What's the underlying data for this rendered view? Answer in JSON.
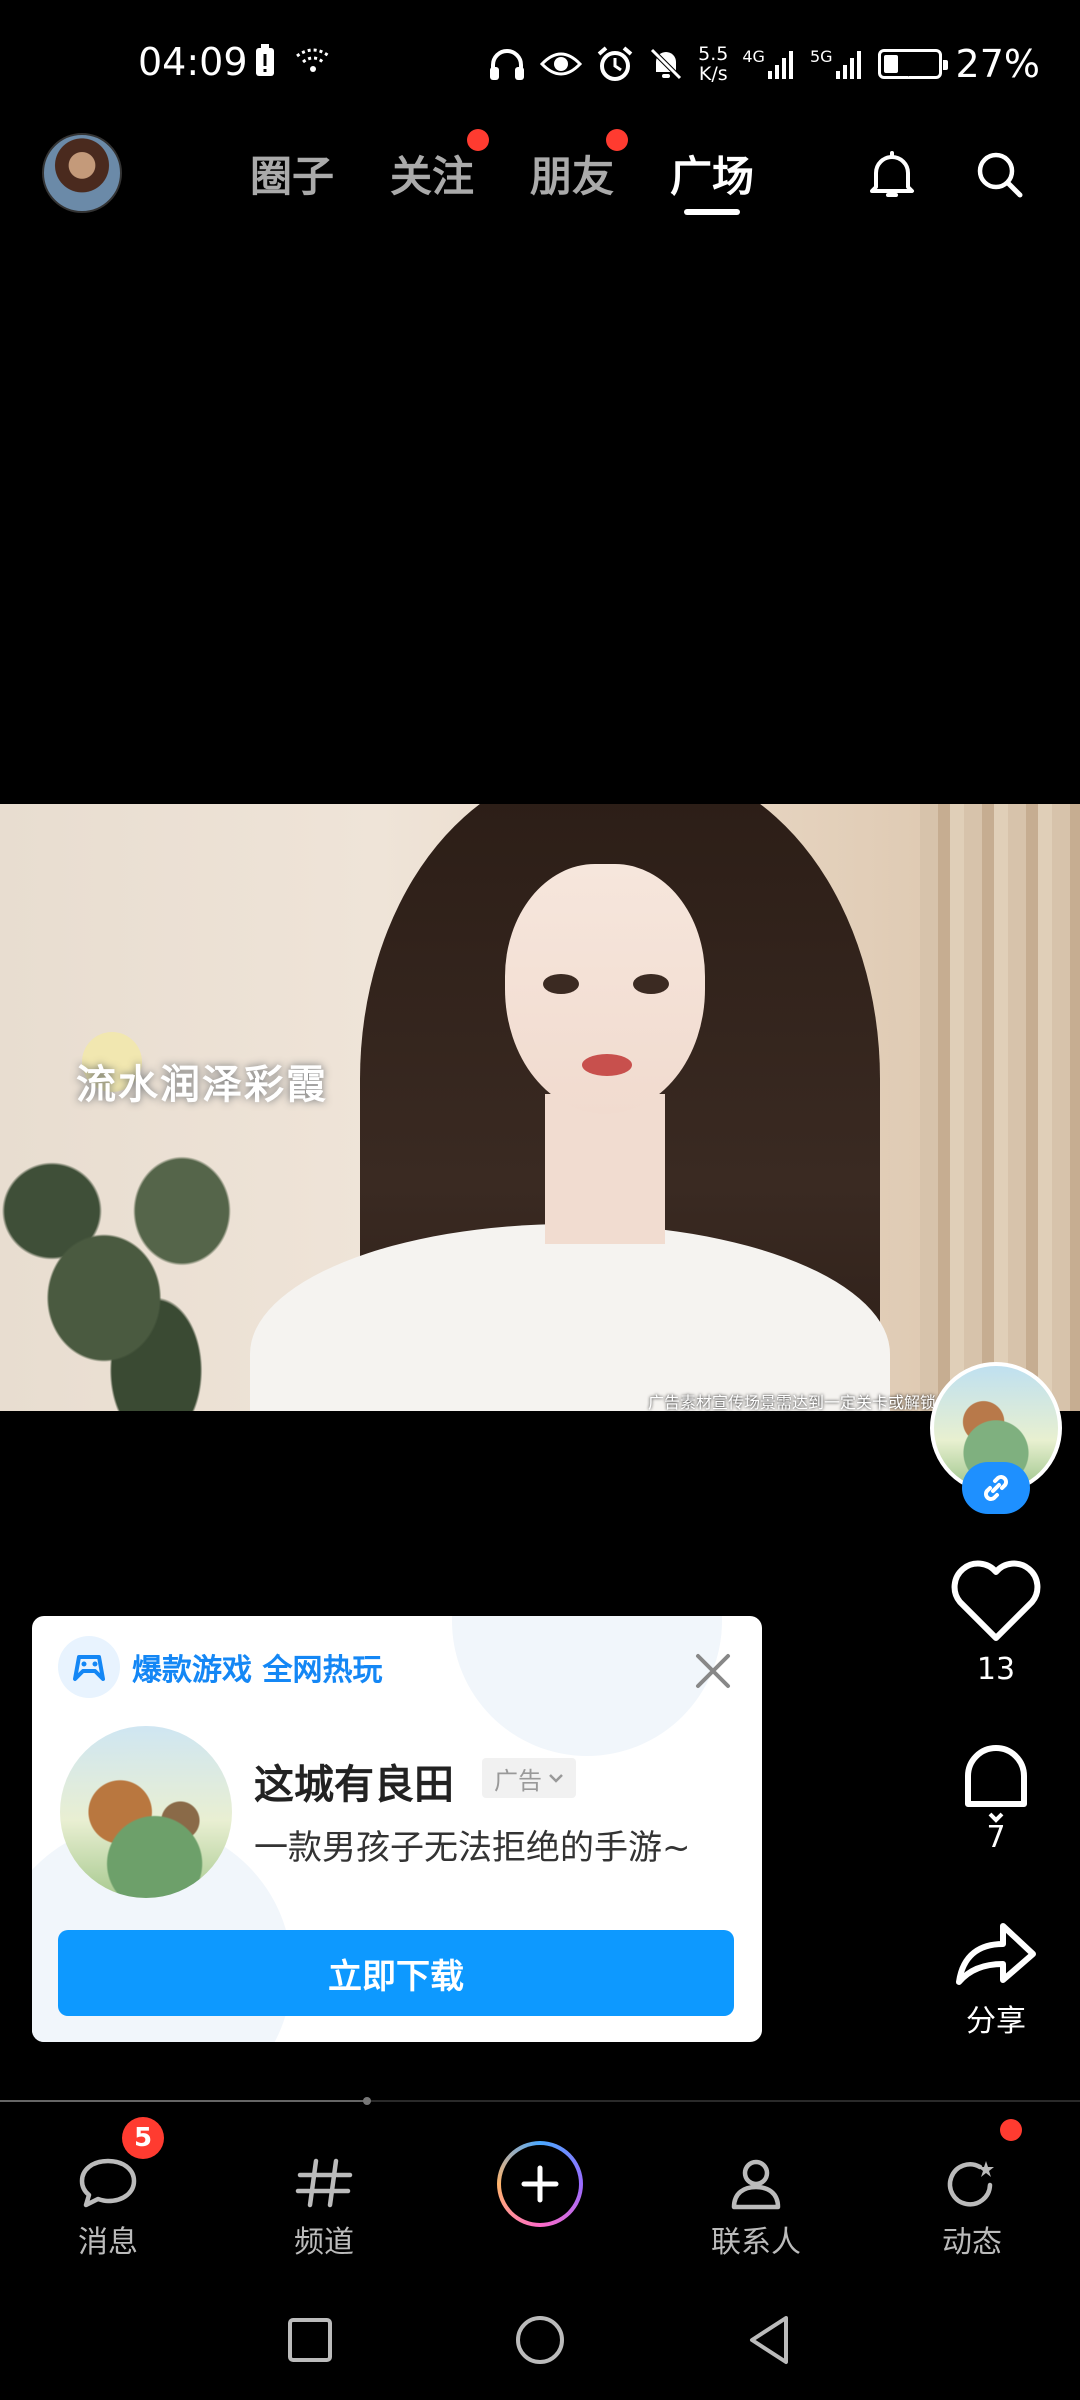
{
  "status_bar": {
    "time": "04:09",
    "net_speed_value": "5.5",
    "net_speed_unit": "K/s",
    "net_4g": "4G",
    "net_5g": "5G",
    "battery_percent": "27%",
    "battery_level": 0.27
  },
  "top_nav": {
    "tabs": [
      {
        "label": "圈子",
        "active": false,
        "has_dot": false
      },
      {
        "label": "关注",
        "active": false,
        "has_dot": true
      },
      {
        "label": "朋友",
        "active": false,
        "has_dot": true
      },
      {
        "label": "广场",
        "active": true,
        "has_dot": false
      }
    ],
    "icons": [
      "bell-icon",
      "search-icon"
    ]
  },
  "video": {
    "overlay_calligraphy": "流水润泽彩霞",
    "disclaimer": "广告素材宣传场景需达到一定关卡或解锁后实现"
  },
  "right_rail": {
    "like_count": "13",
    "comment_count": "7",
    "share_label": "分享"
  },
  "ad_card": {
    "header": "爆款游戏 全网热玩",
    "app_name": "这城有良田",
    "tag": "广告",
    "description": "一款男孩子无法拒绝的手游~",
    "button": "立即下载",
    "accent_color": "#0d99ff"
  },
  "progress": {
    "played_fraction": 0.34
  },
  "bottom_nav": {
    "items": [
      {
        "label": "消息",
        "icon": "message-icon",
        "badge": "5"
      },
      {
        "label": "频道",
        "icon": "hashtag-icon"
      },
      {
        "label": "联系人",
        "icon": "contacts-icon"
      },
      {
        "label": "动态",
        "icon": "refresh-star-icon",
        "has_dot": true
      }
    ]
  },
  "colors": {
    "badge_red": "#ff3b30",
    "brand_blue": "#1487f5"
  }
}
